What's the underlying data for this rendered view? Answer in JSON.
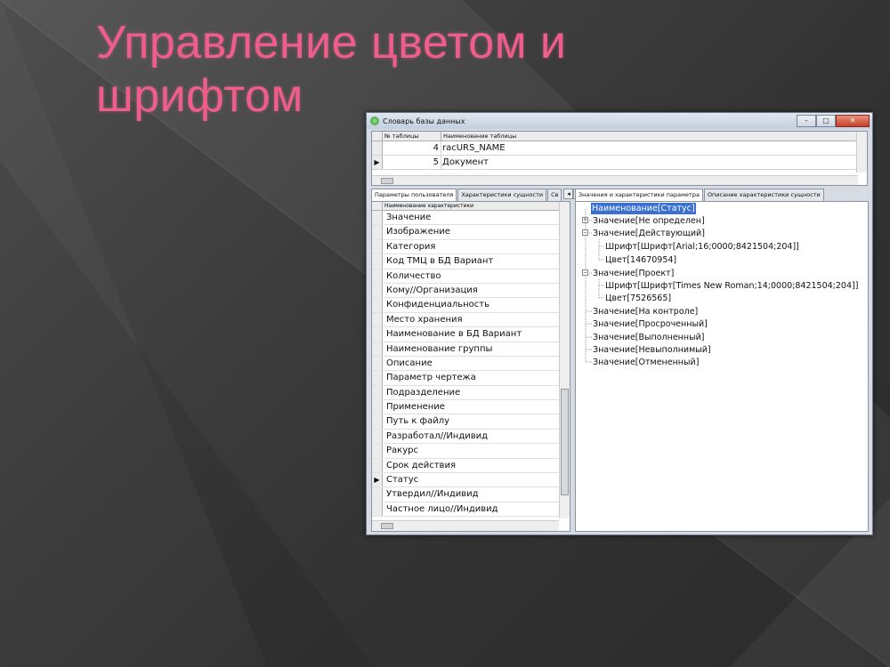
{
  "slide": {
    "title_line1": "Управление цветом и",
    "title_line2": "шрифтом"
  },
  "window": {
    "title": "Словарь базы данных",
    "btn_min": "–",
    "btn_max": "□",
    "btn_close": "✕"
  },
  "top_grid": {
    "col_num": "№ таблицы",
    "col_name": "Наименование таблицы",
    "rows": [
      {
        "indicator": "",
        "num": "4",
        "name": "racURS_NAME"
      },
      {
        "indicator": "▶",
        "num": "5",
        "name": "Документ"
      }
    ]
  },
  "left_tabs": [
    "Параметры пользователя",
    "Характеристики сущности",
    "Св"
  ],
  "left_tab_arrows": [
    "◂",
    "▸"
  ],
  "right_tabs": [
    "Значения и характеристики параметра",
    "Описание характеристики сущности"
  ],
  "left_list": {
    "header": "Наименование характеристики",
    "items": [
      {
        "indicator": "",
        "label": "Значение"
      },
      {
        "indicator": "",
        "label": "Изображение"
      },
      {
        "indicator": "",
        "label": "Категория"
      },
      {
        "indicator": "",
        "label": "Код ТМЦ в БД Вариант"
      },
      {
        "indicator": "",
        "label": "Количество"
      },
      {
        "indicator": "",
        "label": "Кому//Организация"
      },
      {
        "indicator": "",
        "label": "Конфиденциальность"
      },
      {
        "indicator": "",
        "label": "Место хранения"
      },
      {
        "indicator": "",
        "label": "Наименование в БД Вариант"
      },
      {
        "indicator": "",
        "label": "Наименование группы"
      },
      {
        "indicator": "",
        "label": "Описание"
      },
      {
        "indicator": "",
        "label": "Параметр чертежа"
      },
      {
        "indicator": "",
        "label": "Подразделение"
      },
      {
        "indicator": "",
        "label": "Применение"
      },
      {
        "indicator": "",
        "label": "Путь к файлу"
      },
      {
        "indicator": "",
        "label": "Разработал//Индивид"
      },
      {
        "indicator": "",
        "label": "Ракурс"
      },
      {
        "indicator": "",
        "label": "Срок действия"
      },
      {
        "indicator": "▶",
        "label": "Статус"
      },
      {
        "indicator": "",
        "label": "Утвердил//Индивид"
      },
      {
        "indicator": "",
        "label": "Частное лицо//Индивид"
      }
    ]
  },
  "tree": {
    "root": "Наименование[Статус]",
    "n1": "Значение[Не определен]",
    "n2": "Значение[Действующий]",
    "n2a": "Шрифт[Шрифт[Arial;16;0000;8421504;204]]",
    "n2b": "Цвет[14670954]",
    "n3": "Значение[Проект]",
    "n3a": "Шрифт[Шрифт[Times New Roman;14;0000;8421504;204]]",
    "n3b": "Цвет[7526565]",
    "n4": "Значение[На контроле]",
    "n5": "Значение[Просроченный]",
    "n6": "Значение[Выполненный]",
    "n7": "Значение[Невыполнимый]",
    "n8": "Значение[Отмененный]",
    "expander_plus": "+",
    "expander_minus": "−"
  },
  "colors": {
    "title": "#ee5d8c",
    "selection": "#3a70d0"
  }
}
